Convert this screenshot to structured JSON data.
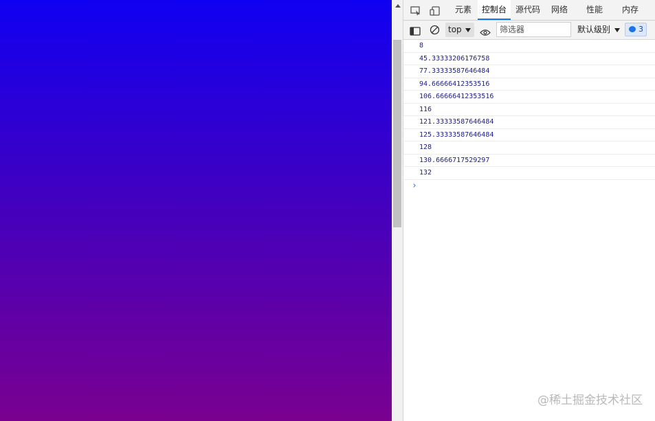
{
  "page": {
    "gradient_top": "#1000f2",
    "gradient_bottom": "#7a0090"
  },
  "devtools": {
    "tabs": [
      {
        "label": "元素",
        "active": false
      },
      {
        "label": "控制台",
        "active": true
      },
      {
        "label": "源代码",
        "active": false
      },
      {
        "label": "网络",
        "active": false
      },
      {
        "label": "性能",
        "active": false
      },
      {
        "label": "内存",
        "active": false
      }
    ],
    "toolbar": {
      "context": "top",
      "filter_placeholder": "筛选器",
      "level": "默认级别",
      "issues_count": "3"
    },
    "console": {
      "lines": [
        "8",
        "45.33333206176758",
        "77.33333587646484",
        "94.66666412353516",
        "106.66666412353516",
        "116",
        "121.33333587646484",
        "125.33333587646484",
        "128",
        "130.6666717529297",
        "132"
      ],
      "prompt": "›"
    }
  },
  "watermark": "@稀土掘金技术社区",
  "colors": {
    "accent": "#1a73e8",
    "console_text": "#1b1b8a"
  }
}
